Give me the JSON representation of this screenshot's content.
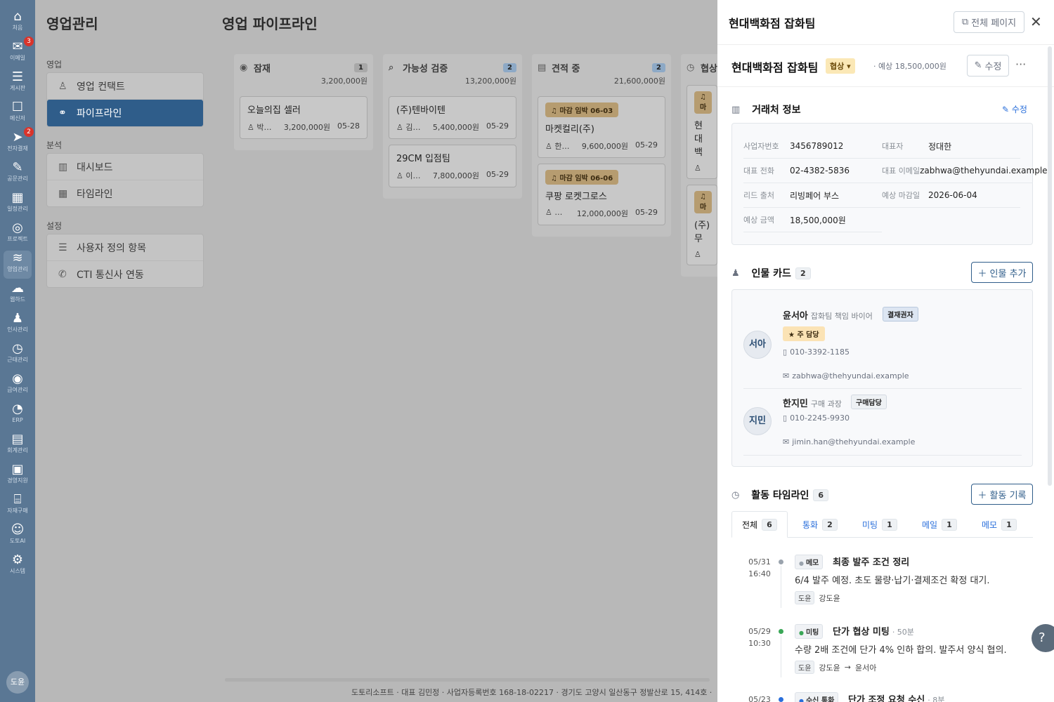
{
  "rail": {
    "items": [
      {
        "label": "처음",
        "icon": "home-icon",
        "glyph": "⌂",
        "badge": ""
      },
      {
        "label": "이메일",
        "icon": "mail-icon",
        "glyph": "✉",
        "badge": "3"
      },
      {
        "label": "게시판",
        "icon": "board-icon",
        "glyph": "☰",
        "badge": ""
      },
      {
        "label": "메신저",
        "icon": "chat-icon",
        "glyph": "☐",
        "badge": ""
      },
      {
        "label": "전자결재",
        "icon": "send-icon",
        "glyph": "➤",
        "badge": "2"
      },
      {
        "label": "공문관리",
        "icon": "document-edit-icon",
        "glyph": "✎",
        "badge": ""
      },
      {
        "label": "일정관리",
        "icon": "calendar-icon",
        "glyph": "▦",
        "badge": ""
      },
      {
        "label": "프로젝트",
        "icon": "target-icon",
        "glyph": "◎",
        "badge": ""
      },
      {
        "label": "영업관리",
        "icon": "sales-icon",
        "glyph": "≋",
        "badge": ""
      },
      {
        "label": "웹하드",
        "icon": "cloud-icon",
        "glyph": "☁",
        "badge": ""
      },
      {
        "label": "인사관리",
        "icon": "people-icon",
        "glyph": "♟",
        "badge": ""
      },
      {
        "label": "근태관리",
        "icon": "clock-icon",
        "glyph": "◷",
        "badge": ""
      },
      {
        "label": "급여관리",
        "icon": "coins-icon",
        "glyph": "◉",
        "badge": ""
      },
      {
        "label": "ERP",
        "icon": "pie-icon",
        "glyph": "◔",
        "badge": ""
      },
      {
        "label": "회계관리",
        "icon": "calculator-icon",
        "glyph": "▤",
        "badge": ""
      },
      {
        "label": "경영지원",
        "icon": "briefcase-icon",
        "glyph": "▣",
        "badge": ""
      },
      {
        "label": "자재구매",
        "icon": "store-icon",
        "glyph": "⌸",
        "badge": ""
      },
      {
        "label": "도토AI",
        "icon": "robot-icon",
        "glyph": "☺",
        "badge": ""
      },
      {
        "label": "시스템",
        "icon": "gear-icon",
        "glyph": "⚙",
        "badge": ""
      }
    ],
    "avatar": "도윤"
  },
  "app_title": "영업관리",
  "page_title": "영업 파이프라인",
  "sidebar": {
    "sec_sales": "영업",
    "sec_analysis": "분석",
    "sec_settings": "설정",
    "contacts": "영업 컨택트",
    "pipeline": "파이프라인",
    "dashboard": "대시보드",
    "timeline": "타임라인",
    "custom_fields": "사용자 정의 항목",
    "cti": "CTI 통신사 연동"
  },
  "columns": [
    {
      "name": "잠재",
      "count": "1",
      "total": "3,200,000원",
      "cards": [
        {
          "badge": "",
          "name": "오늘의집 셀러",
          "owner": "박…",
          "amount": "3,200,000원",
          "date": "05-28"
        }
      ]
    },
    {
      "name": "가능성 검증",
      "count": "2",
      "total": "13,200,000원",
      "cards": [
        {
          "badge": "",
          "name": "(주)텐바이텐",
          "owner": "김…",
          "amount": "5,400,000원",
          "date": "05-29"
        },
        {
          "badge": "",
          "name": "29CM 입점팀",
          "owner": "이…",
          "amount": "7,800,000원",
          "date": "05-29"
        }
      ]
    },
    {
      "name": "견적 중",
      "count": "2",
      "total": "21,600,000원",
      "cards": [
        {
          "badge": "마감 임박 06-03",
          "name": "마켓컬리(주)",
          "owner": "한…",
          "amount": "9,600,000원",
          "date": "05-29"
        },
        {
          "badge": "마감 임박 06-06",
          "name": "쿠팡 로켓그로스",
          "owner": "…",
          "amount": "12,000,000원",
          "date": "05-29"
        }
      ]
    },
    {
      "name": "협상",
      "count": "",
      "total": "",
      "cards": [
        {
          "badge": "마",
          "name": "현대백",
          "owner": "",
          "amount": "",
          "date": ""
        },
        {
          "badge": "마",
          "name": "(주)무",
          "owner": "",
          "amount": "",
          "date": ""
        }
      ]
    }
  ],
  "footer": "도토리소프트 · 대표 김민정 · 사업자등록번호 168-18-02217 · 경기도 고양시 일산동구 정발산로 15, 414호 ·",
  "panel": {
    "top_title": "현대백화점 잡화팀",
    "full_page_label": "전체 페이지",
    "deal_title": "현대백화점 잡화팀",
    "stage": "협상",
    "amount": "· 예상 18,500,000원",
    "edit_label": "수정",
    "more": "···",
    "account": {
      "title": "거래처 정보",
      "edit": "수정",
      "fields": [
        {
          "k": "사업자번호",
          "v": "3456789012"
        },
        {
          "k": "대표자",
          "v": "정대한"
        },
        {
          "k": "대표 전화",
          "v": "02-4382-5836"
        },
        {
          "k": "대표 이메일",
          "v": "zabhwa@thehyundai.example"
        },
        {
          "k": "리드 출처",
          "v": "리빙페어 부스"
        },
        {
          "k": "예상 마감일",
          "v": "2026-06-04"
        },
        {
          "k": "예상 금액",
          "v": "18,500,000원"
        }
      ]
    },
    "people": {
      "title": "인물 카드",
      "count": "2",
      "add": "인물 추가",
      "list": [
        {
          "initials": "서아",
          "name": "윤서아",
          "role": "잡화팀 책임 바이어",
          "tag": "결재권자",
          "primary": "주 담당",
          "phone": "010-3392-1185",
          "email": "zabhwa@thehyundai.example"
        },
        {
          "initials": "지민",
          "name": "한지민",
          "role": "구매 과장",
          "tag": "구매담당",
          "primary": "",
          "phone": "010-2245-9930",
          "email": "jimin.han@thehyundai.example"
        }
      ]
    },
    "activity": {
      "title": "활동 타임라인",
      "count": "6",
      "add": "활동 기록",
      "tabs": [
        {
          "label": "전체",
          "count": "6"
        },
        {
          "label": "통화",
          "count": "2"
        },
        {
          "label": "미팅",
          "count": "1"
        },
        {
          "label": "메일",
          "count": "1"
        },
        {
          "label": "메모",
          "count": "1"
        }
      ],
      "items": [
        {
          "date": "05/31",
          "time": "16:40",
          "type": "메모",
          "title": "최종 발주 조건 정리",
          "duration": "",
          "body": "6/4 발주 예정. 초도 물량·납기·결제조건 확정 대기.",
          "author_badge": "도윤",
          "author": "강도윤",
          "arrow": "",
          "target": "",
          "dot": "#9aa3ad"
        },
        {
          "date": "05/29",
          "time": "10:30",
          "type": "미팅",
          "title": "단가 협상 미팅",
          "duration": "· 50분",
          "body": "수량 2배 조건에 단가 4% 인하 합의. 발주서 양식 협의.",
          "author_badge": "도윤",
          "author": "강도윤",
          "arrow": "→",
          "target": "윤서아",
          "dot": "#3aa757"
        },
        {
          "date": "05/23",
          "time": "",
          "type": "수신 통화",
          "title": "단가 조정 요청 수신",
          "duration": "· 8분",
          "body": "",
          "author_badge": "",
          "author": "",
          "arrow": "",
          "target": "",
          "dot": "#2a6fdb"
        }
      ]
    }
  },
  "colors": {
    "rail": "#5a7794",
    "accent": "#2a6fdb",
    "active_menu": "#2f5d8a",
    "stage_badge": "#fbe8b6"
  }
}
